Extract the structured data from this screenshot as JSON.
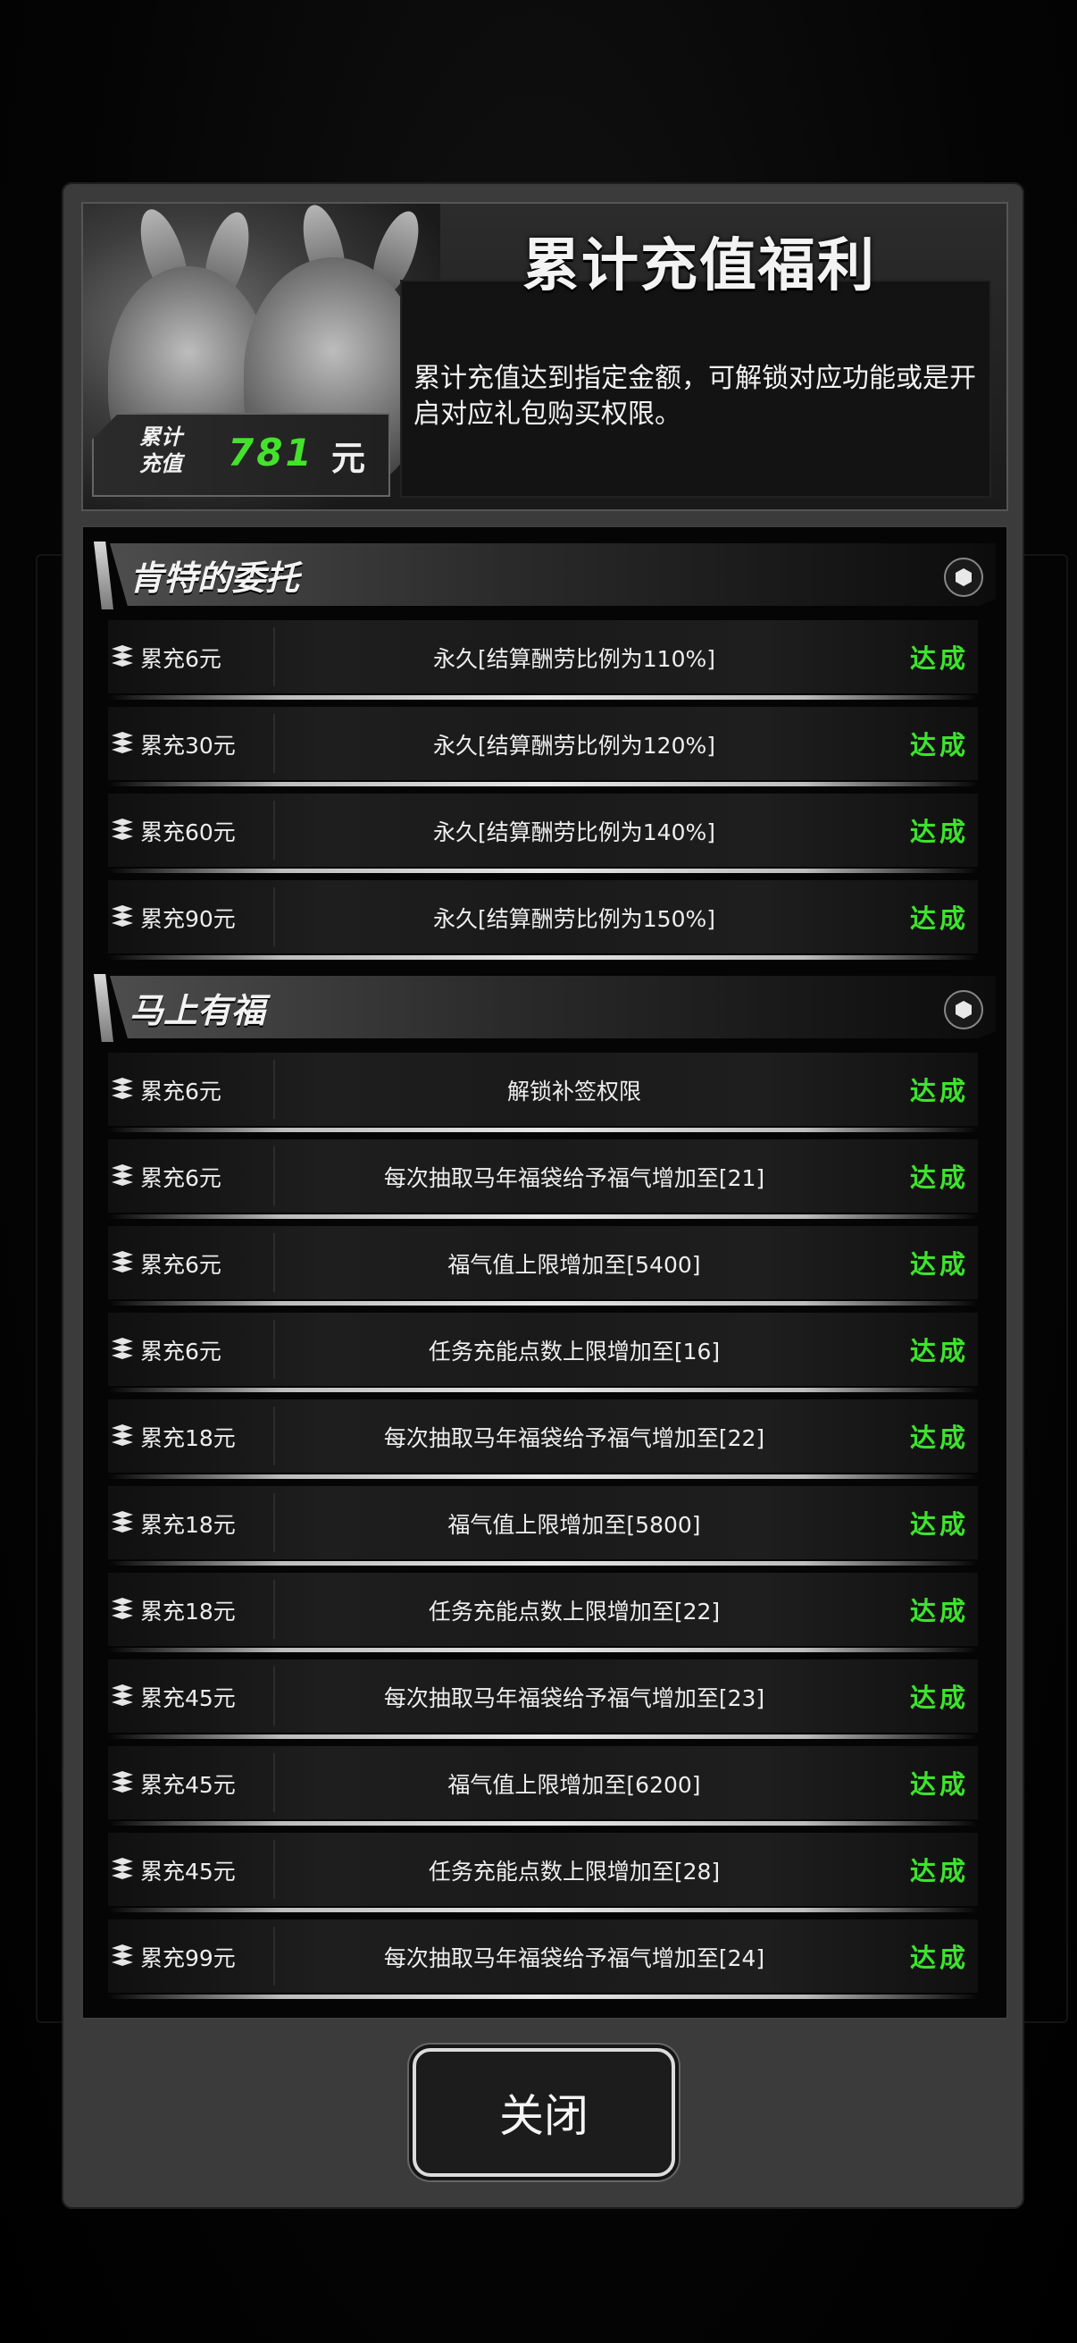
{
  "header": {
    "title": "累计充值福利",
    "description": "累计充值达到指定金额，可解锁对应功能或是开启对应礼包购买权限。",
    "total_label": "累计充值",
    "total_value": "781",
    "total_unit": "元"
  },
  "sections": [
    {
      "title": "肯特的委托",
      "rows": [
        {
          "amount": "累充6元",
          "reward": "永久[结算酬劳比例为110%]",
          "status": "达成"
        },
        {
          "amount": "累充30元",
          "reward": "永久[结算酬劳比例为120%]",
          "status": "达成"
        },
        {
          "amount": "累充60元",
          "reward": "永久[结算酬劳比例为140%]",
          "status": "达成"
        },
        {
          "amount": "累充90元",
          "reward": "永久[结算酬劳比例为150%]",
          "status": "达成"
        }
      ]
    },
    {
      "title": "马上有福",
      "rows": [
        {
          "amount": "累充6元",
          "reward": "解锁补签权限",
          "status": "达成"
        },
        {
          "amount": "累充6元",
          "reward": "每次抽取马年福袋给予福气增加至[21]",
          "status": "达成"
        },
        {
          "amount": "累充6元",
          "reward": "福气值上限增加至[5400]",
          "status": "达成"
        },
        {
          "amount": "累充6元",
          "reward": "任务充能点数上限增加至[16]",
          "status": "达成"
        },
        {
          "amount": "累充18元",
          "reward": "每次抽取马年福袋给予福气增加至[22]",
          "status": "达成"
        },
        {
          "amount": "累充18元",
          "reward": "福气值上限增加至[5800]",
          "status": "达成"
        },
        {
          "amount": "累充18元",
          "reward": "任务充能点数上限增加至[22]",
          "status": "达成"
        },
        {
          "amount": "累充45元",
          "reward": "每次抽取马年福袋给予福气增加至[23]",
          "status": "达成"
        },
        {
          "amount": "累充45元",
          "reward": "福气值上限增加至[6200]",
          "status": "达成"
        },
        {
          "amount": "累充45元",
          "reward": "任务充能点数上限增加至[28]",
          "status": "达成"
        },
        {
          "amount": "累充99元",
          "reward": "每次抽取马年福袋给予福气增加至[24]",
          "status": "达成"
        }
      ]
    }
  ],
  "close_label": "关闭",
  "colors": {
    "accent_green": "#3de32d",
    "panel": "#3b3b3b"
  }
}
